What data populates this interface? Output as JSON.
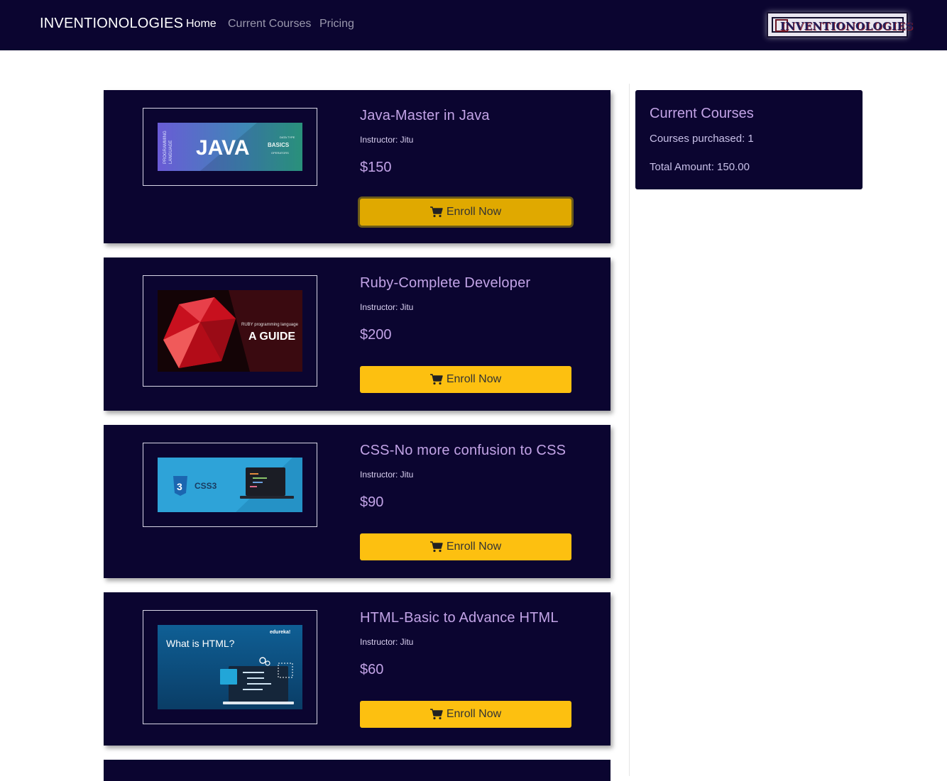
{
  "nav": {
    "brand": "INVENTIONOLOGIES",
    "links": [
      "Home",
      "Current Courses",
      "Pricing"
    ],
    "logo_text": "INVENTIONOLOGIES"
  },
  "courses": [
    {
      "title": "Java-Master in Java",
      "instructor": "Instructor: Jitu",
      "price": "$150",
      "button": "Enroll Now",
      "image": "java-thumbnail",
      "image_text": "JAVA"
    },
    {
      "title": "Ruby-Complete Developer",
      "instructor": "Instructor: Jitu",
      "price": "$200",
      "button": "Enroll Now",
      "image": "ruby-thumbnail",
      "image_text": "A GUIDE"
    },
    {
      "title": "CSS-No more confusion to CSS",
      "instructor": "Instructor: Jitu",
      "price": "$90",
      "button": "Enroll Now",
      "image": "css-thumbnail",
      "image_text": "CSS3"
    },
    {
      "title": "HTML-Basic to Advance HTML",
      "instructor": "Instructor: Jitu",
      "price": "$60",
      "button": "Enroll Now",
      "image": "html-thumbnail",
      "image_text": "What is HTML?"
    }
  ],
  "summary": {
    "title": "Current Courses",
    "purchased": "Courses purchased: 1",
    "total": "Total Amount: 150.00"
  },
  "colors": {
    "navy": "#0b0530",
    "accent_text": "#c2a3e6",
    "button_yellow": "#fdc010"
  },
  "icons": {
    "cart": "shopping-cart-icon"
  }
}
